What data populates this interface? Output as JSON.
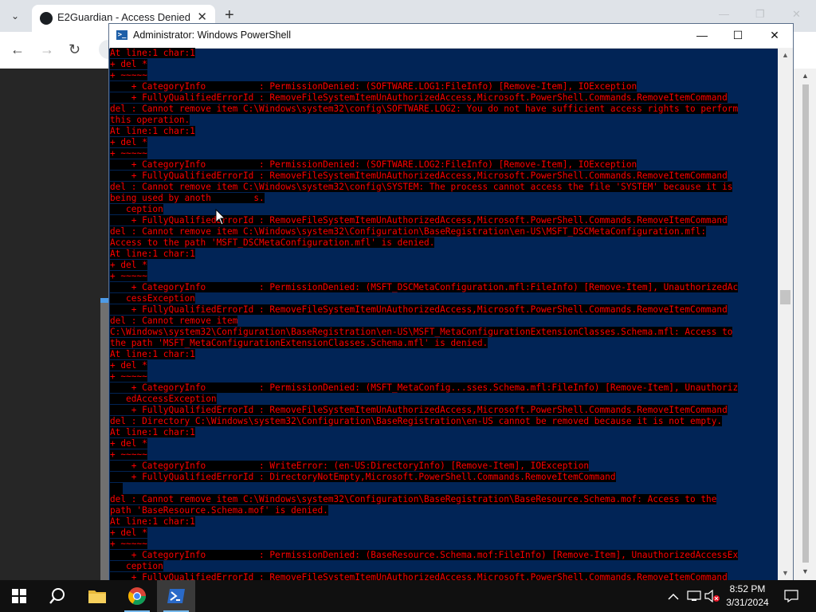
{
  "browser": {
    "tab_title": "E2Guardian - Access Denied",
    "tab_close": "✕",
    "new_tab": "+",
    "tab_list": "⌄",
    "back": "←",
    "forward": "→",
    "reload": "↻",
    "win_minimize": "—",
    "win_restore": "❐",
    "win_close": "✕",
    "scroll_up": "▲",
    "scroll_down": "▼"
  },
  "powershell": {
    "title": "Administrator: Windows PowerShell",
    "minimize": "—",
    "maximize": "☐",
    "close": "✕",
    "lines": [
      "At line:1 char:1",
      "+ del *",
      "+ ~~~~~",
      "    + CategoryInfo          : PermissionDenied: (SOFTWARE.LOG1:FileInfo) [Remove-Item], IOException",
      "    + FullyQualifiedErrorId : RemoveFileSystemItemUnAuthorizedAccess,Microsoft.PowerShell.Commands.RemoveItemCommand",
      "del : Cannot remove item C:\\Windows\\system32\\config\\SOFTWARE.LOG2: You do not have sufficient access rights to perform",
      "this operation.",
      "At line:1 char:1",
      "+ del *",
      "+ ~~~~~",
      "    + CategoryInfo          : PermissionDenied: (SOFTWARE.LOG2:FileInfo) [Remove-Item], IOException",
      "    + FullyQualifiedErrorId : RemoveFileSystemItemUnAuthorizedAccess,Microsoft.PowerShell.Commands.RemoveItemCommand",
      "del : Cannot remove item C:\\Windows\\system32\\config\\SYSTEM: The process cannot access the file 'SYSTEM' because it is",
      "being used by anoth        s.",
      "   ception",
      "    + FullyQualifiedErrorId : RemoveFileSystemItemUnAuthorizedAccess,Microsoft.PowerShell.Commands.RemoveItemCommand",
      "del : Cannot remove item C:\\Windows\\system32\\Configuration\\BaseRegistration\\en-US\\MSFT_DSCMetaConfiguration.mfl:",
      "Access to the path 'MSFT_DSCMetaConfiguration.mfl' is denied.",
      "At line:1 char:1",
      "+ del *",
      "+ ~~~~~",
      "    + CategoryInfo          : PermissionDenied: (MSFT_DSCMetaConfiguration.mfl:FileInfo) [Remove-Item], UnauthorizedAc",
      "   cessException",
      "    + FullyQualifiedErrorId : RemoveFileSystemItemUnAuthorizedAccess,Microsoft.PowerShell.Commands.RemoveItemCommand",
      "del : Cannot remove item",
      "C:\\Windows\\system32\\Configuration\\BaseRegistration\\en-US\\MSFT_MetaConfigurationExtensionClasses.Schema.mfl: Access to",
      "the path 'MSFT_MetaConfigurationExtensionClasses.Schema.mfl' is denied.",
      "At line:1 char:1",
      "+ del *",
      "+ ~~~~~",
      "    + CategoryInfo          : PermissionDenied: (MSFT_MetaConfig...sses.Schema.mfl:FileInfo) [Remove-Item], Unauthoriz",
      "   edAccessException",
      "    + FullyQualifiedErrorId : RemoveFileSystemItemUnAuthorizedAccess,Microsoft.PowerShell.Commands.RemoveItemCommand",
      "del : Directory C:\\Windows\\system32\\Configuration\\BaseRegistration\\en-US cannot be removed because it is not empty.",
      "At line:1 char:1",
      "+ del *",
      "+ ~~~~~",
      "    + CategoryInfo          : WriteError: (en-US:DirectoryInfo) [Remove-Item], IOException",
      "    + FullyQualifiedErrorId : DirectoryNotEmpty,Microsoft.PowerShell.Commands.RemoveItemCommand",
      "",
      "del : Cannot remove item C:\\Windows\\system32\\Configuration\\BaseRegistration\\BaseResource.Schema.mof: Access to the",
      "path 'BaseResource.Schema.mof' is denied.",
      "At line:1 char:1",
      "+ del *",
      "+ ~~~~~",
      "    + CategoryInfo          : PermissionDenied: (BaseResource.Schema.mof:FileInfo) [Remove-Item], UnauthorizedAccessEx",
      "   ception",
      "    + FullyQualifiedErrorId : RemoveFileSystemItemUnAuthorizedAccess,Microsoft.PowerShell.Commands.RemoveItemCommand"
    ]
  },
  "taskbar": {
    "time": "8:52 PM",
    "date": "3/31/2024"
  },
  "colors": {
    "console_bg": "#012456",
    "error_fg": "#ff0000",
    "error_bg": "#000000",
    "taskbar_bg": "#101010"
  },
  "icons": {
    "start": "windows-start-icon",
    "search": "search-icon",
    "explorer": "file-explorer-icon",
    "chrome": "chrome-icon",
    "powershell": "powershell-icon",
    "tray_overflow": "chevron-up-icon",
    "network": "network-icon",
    "volume": "volume-muted-icon",
    "notifications": "notification-icon"
  }
}
